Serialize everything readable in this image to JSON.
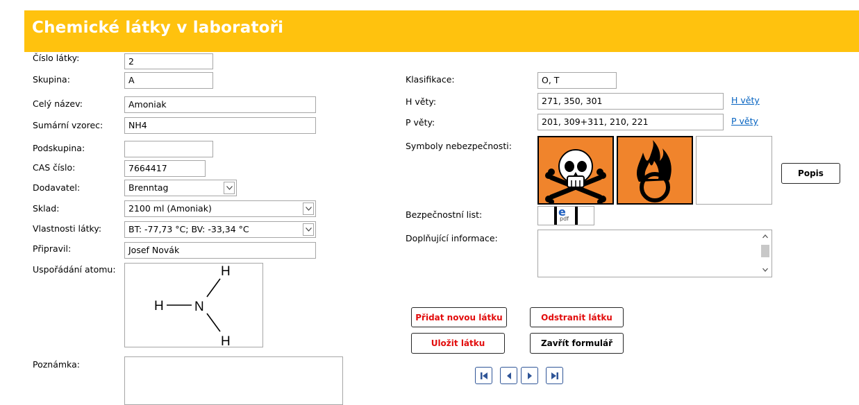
{
  "header": {
    "title": "Chemické látky v laboratoři"
  },
  "form": {
    "cislo_latky": {
      "label": "Číslo látky:",
      "value": "2"
    },
    "skupina": {
      "label": "Skupina:",
      "value": "A"
    },
    "cely_nazev": {
      "label": "Celý název:",
      "value": "Amoniak"
    },
    "sumarni_vzorec": {
      "label": "Sumární vzorec:",
      "value": "NH4"
    },
    "podskupina": {
      "label": "Podskupina:",
      "value": ""
    },
    "cas_cislo": {
      "label": "CAS číslo:",
      "value": "7664417"
    },
    "dodavatel": {
      "label": "Dodavatel:",
      "value": "Brenntag"
    },
    "sklad": {
      "label": "Sklad:",
      "value": "2100 ml (Amoniak)"
    },
    "vlastnosti": {
      "label": "Vlastnosti látky:",
      "value": "BT: -77,73 °C; BV: -33,34 °C"
    },
    "pripravil": {
      "label": "Připravil:",
      "value": "Josef Novák"
    },
    "usporadani": {
      "label": "Uspořádání atomu:"
    },
    "poznamka": {
      "label": "Poznámka:",
      "value": ""
    },
    "klasifikace": {
      "label": "Klasifikace:",
      "value": "O, T"
    },
    "h_vety": {
      "label": "H věty:",
      "value": "271, 350, 301",
      "link": "H věty"
    },
    "p_vety": {
      "label": "P věty:",
      "value": "201, 309+311, 210, 221",
      "link": "P věty"
    },
    "symboly": {
      "label": "Symboly nebezpečnosti:"
    },
    "bezpecnostni_list": {
      "label": "Bezpečnostní list:"
    },
    "doplnujici": {
      "label": "Doplňující informace:",
      "value": ""
    }
  },
  "molecule": {
    "atoms": [
      "H",
      "N",
      "H",
      "H"
    ]
  },
  "hazard_symbols": [
    "skull-crossbones-icon",
    "oxidizer-flame-icon"
  ],
  "pdf_icon_text": "pdf",
  "buttons": {
    "popis": "Popis",
    "pridat": "Přidat novou látku",
    "odstranit": "Odstranit látku",
    "ulozit": "Uložit látku",
    "zavrit": "Zavřít formulář"
  },
  "colors": {
    "header": "#ffc20e",
    "hazard_orange": "#f0842c",
    "red_button_text": "#e20d0d",
    "link": "#0563c1",
    "nav_border": "#2f5597"
  }
}
